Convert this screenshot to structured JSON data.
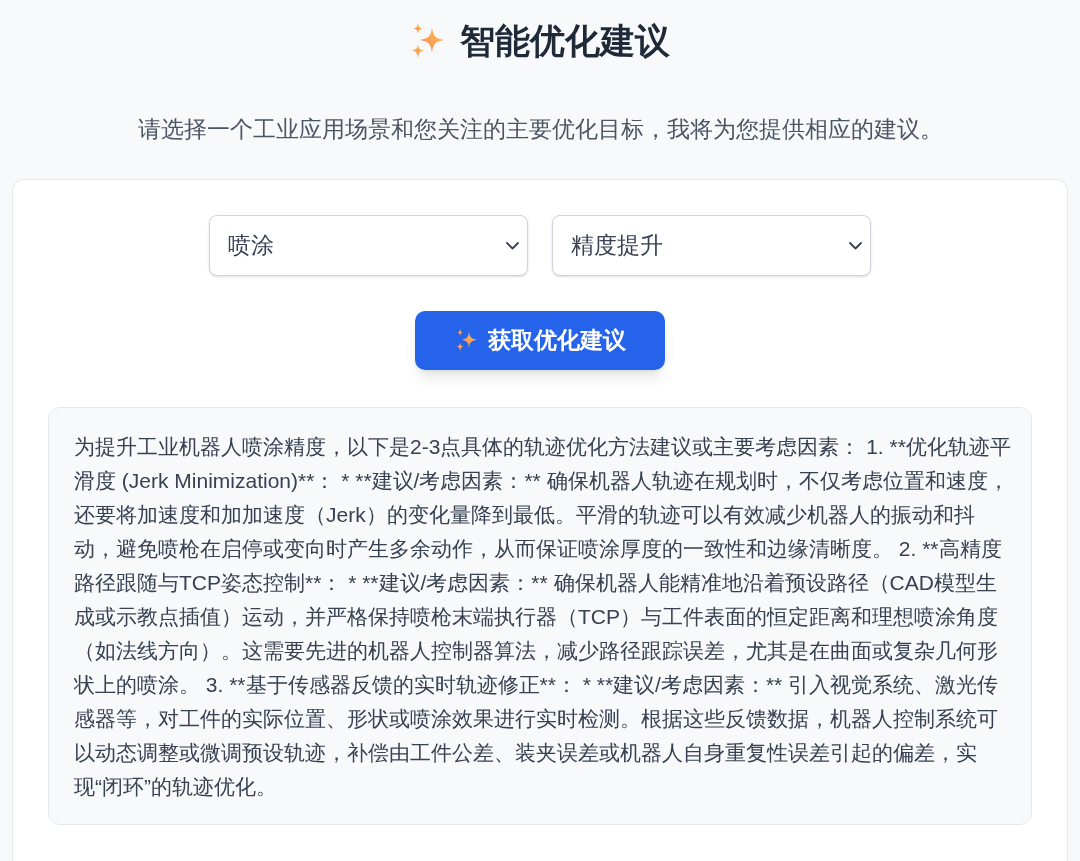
{
  "header": {
    "title": "智能优化建议",
    "subtitle": "请选择一个工业应用场景和您关注的主要优化目标，我将为您提供相应的建议。"
  },
  "form": {
    "selects": [
      {
        "value": "喷涂"
      },
      {
        "value": "精度提升"
      }
    ],
    "button": {
      "label": "获取优化建议"
    }
  },
  "result": {
    "text": "为提升工业机器人喷涂精度，以下是2-3点具体的轨迹优化方法建议或主要考虑因素： 1. **优化轨迹平滑度 (Jerk Minimization)**： * **建议/考虑因素：** 确保机器人轨迹在规划时，不仅考虑位置和速度，还要将加速度和加加速度（Jerk）的变化量降到最低。平滑的轨迹可以有效减少机器人的振动和抖动，避免喷枪在启停或变向时产生多余动作，从而保证喷涂厚度的一致性和边缘清晰度。 2. **高精度路径跟随与TCP姿态控制**： * **建议/考虑因素：** 确保机器人能精准地沿着预设路径（CAD模型生成或示教点插值）运动，并严格保持喷枪末端执行器（TCP）与工件表面的恒定距离和理想喷涂角度（如法线方向）。这需要先进的机器人控制器算法，减少路径跟踪误差，尤其是在曲面或复杂几何形状上的喷涂。 3. **基于传感器反馈的实时轨迹修正**： * **建议/考虑因素：** 引入视觉系统、激光传感器等，对工件的实际位置、形状或喷涂效果进行实时检测。根据这些反馈数据，机器人控制系统可以动态调整或微调预设轨迹，补偿由工件公差、装夹误差或机器人自身重复性误差引起的偏差，实现“闭环”的轨迹优化。"
  }
}
